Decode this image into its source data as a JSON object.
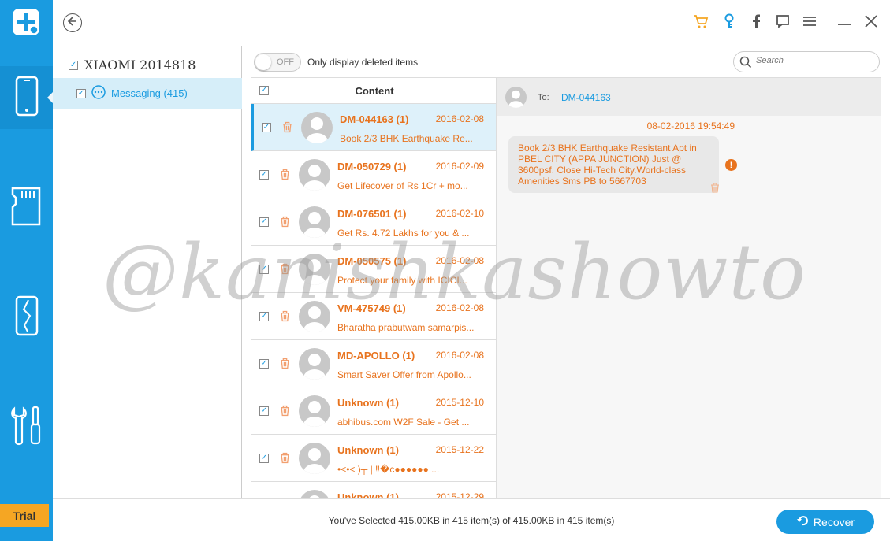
{
  "app": {
    "trial_label": "Trial"
  },
  "rail": {
    "items": [
      {
        "icon": "phone-icon"
      },
      {
        "icon": "sd-card-icon"
      },
      {
        "icon": "broken-phone-icon"
      },
      {
        "icon": "tools-icon"
      }
    ]
  },
  "tree": {
    "device_name": "XIAOMI 2014818",
    "messaging_label": "Messaging (415)"
  },
  "toolbar": {
    "toggle_label": "OFF",
    "only_deleted_label": "Only display deleted items",
    "search_placeholder": "Search"
  },
  "list": {
    "header": "Content",
    "rows": [
      {
        "sender": "DM-044163 (1)",
        "date": "2016-02-08",
        "preview": "Book 2/3 BHK Earthquake Re..."
      },
      {
        "sender": "DM-050729 (1)",
        "date": "2016-02-09",
        "preview": "Get Lifecover of Rs 1Cr + mo..."
      },
      {
        "sender": "DM-076501 (1)",
        "date": "2016-02-10",
        "preview": "Get Rs. 4.72 Lakhs for you & ..."
      },
      {
        "sender": "DM-050575 (1)",
        "date": "2016-02-08",
        "preview": "Protect your family with ICICI..."
      },
      {
        "sender": "VM-475749 (1)",
        "date": "2016-02-08",
        "preview": "Bharatha prabutwam samarpis..."
      },
      {
        "sender": "MD-APOLLO (1)",
        "date": "2016-02-08",
        "preview": "Smart Saver Offer from Apollo..."
      },
      {
        "sender": "Unknown (1)",
        "date": "2015-12-10",
        "preview": "abhibus.com W2F Sale - Get ..."
      },
      {
        "sender": "Unknown (1)",
        "date": "2015-12-22",
        "preview": "•<•<  )┬ |     ‼�c●●●●●●  ..."
      },
      {
        "sender": "Unknown (1)",
        "date": "2015-12-29",
        "preview": ""
      }
    ]
  },
  "detail": {
    "to_label": "To:",
    "to_address": "DM-044163",
    "timestamp": "08-02-2016 19:54:49",
    "message": "Book 2/3 BHK Earthquake Resistant Apt in PBEL CITY (APPA JUNCTION) Just @ 3600psf. Close Hi-Tech City.World-class Amenities Sms PB to 5667703",
    "warning_glyph": "!"
  },
  "footer": {
    "summary": "You've Selected 415.00KB in 415 item(s) of 415.00KB in 415 item(s)",
    "recover_label": "Recover"
  },
  "watermark": "@kanishkashowto",
  "colors": {
    "accent": "#1a9be0",
    "sender": "#e8731e",
    "trial": "#f5a623"
  }
}
